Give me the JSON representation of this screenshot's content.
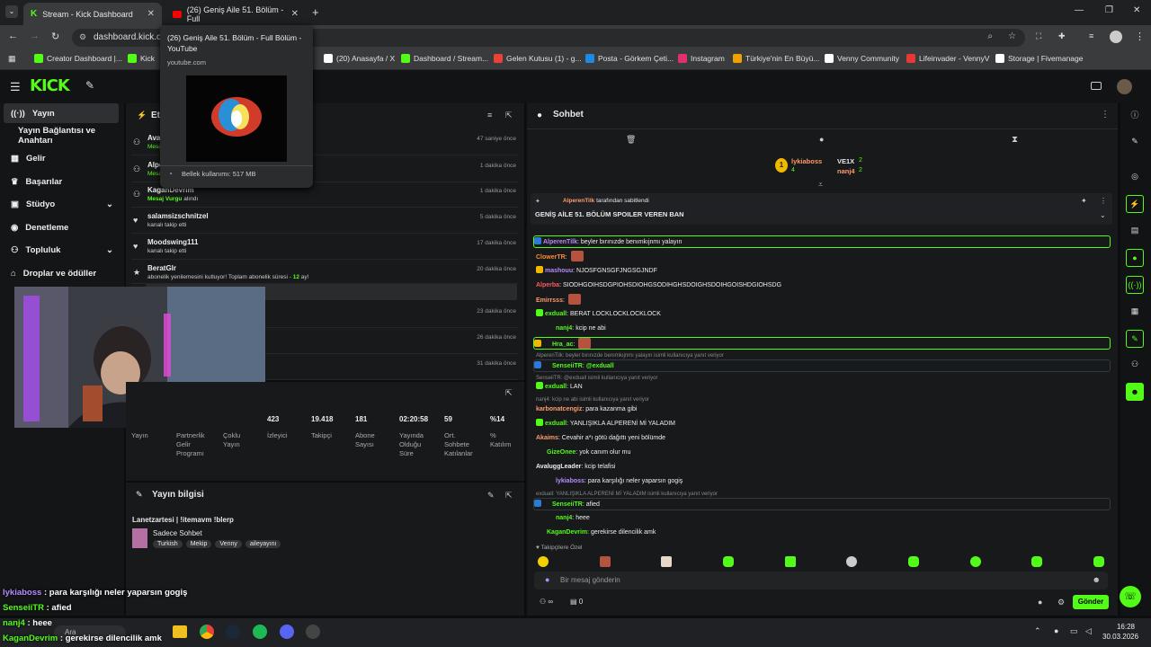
{
  "browser": {
    "tabs": [
      {
        "title": "Stream - Kick Dashboard",
        "active": true
      },
      {
        "title": "(26) Geniş Aile 51. Bölüm - Full",
        "active": false
      }
    ],
    "url": "dashboard.kick.co",
    "bookmarks": [
      {
        "label": "Creator Dashboard |...",
        "color": "#53fc18"
      },
      {
        "label": "Kick",
        "color": "#53fc18"
      },
      {
        "label": "(20) Anasayfa / X",
        "color": "#ffffff"
      },
      {
        "label": "Dashboard / Stream...",
        "color": "#53fc18"
      },
      {
        "label": "Gelen Kutusu (1) - g...",
        "color": "#ea4335"
      },
      {
        "label": "Posta - Görkem Çeti...",
        "color": "#1e88e5"
      },
      {
        "label": "Instagram",
        "color": "#e1306c"
      },
      {
        "label": "Türkiye'nin En Büyü...",
        "color": "#f0a000"
      },
      {
        "label": "Venny Community",
        "color": "#ffffff"
      },
      {
        "label": "Lifeinvader - VennyV",
        "color": "#e53935"
      },
      {
        "label": "Storage | Fivemanage",
        "color": "#ffffff"
      }
    ],
    "tooltip": {
      "title": "(26) Geniş Aile 51. Bölüm - Full Bölüm - YouTube",
      "domain": "youtube.com",
      "memory": "Bellek kullanımı: 517 MB"
    }
  },
  "sidebar": {
    "items": [
      {
        "label": "Yayın",
        "icon": "broadcast-icon",
        "active": true
      },
      {
        "label": "Yayın Bağlantısı ve Anahtarı",
        "icon": "",
        "active": false
      },
      {
        "label": "Gelir",
        "icon": "revenue-icon",
        "active": false
      },
      {
        "label": "Başarılar",
        "icon": "trophy-icon",
        "active": false
      },
      {
        "label": "Stüdyo",
        "icon": "studio-icon",
        "active": false,
        "chevron": true
      },
      {
        "label": "Denetleme",
        "icon": "moderation-icon",
        "active": false
      },
      {
        "label": "Topluluk",
        "icon": "community-icon",
        "active": false,
        "chevron": true
      },
      {
        "label": "Droplar ve ödüller",
        "icon": "drops-icon",
        "active": false
      }
    ]
  },
  "events": {
    "title": "Et",
    "items": [
      {
        "name": "Ava",
        "sub": "Mesa",
        "time": "47 saniye önce"
      },
      {
        "name": "Alpe",
        "sub": "Mesa",
        "time": "1 dakika önce"
      },
      {
        "name": "KaganDevrim",
        "sub": "Mesaj Vurgu",
        "sub2": "alındı",
        "time": "1 dakika önce"
      },
      {
        "name": "salamsizschnitzel",
        "sub": "kanalı takip etti",
        "time": "5 dakika önce"
      },
      {
        "name": "Moodswing111",
        "sub": "kanalı takip etti",
        "time": "17 dakika önce"
      },
      {
        "name": "BeratGlr",
        "sub": "abonelik yenilemesini kutluyor! Toplam abonelik süresi -",
        "sub2": "12",
        "sub3": "ay!",
        "time": "20 dakika önce"
      },
      {
        "name": "",
        "sub": "",
        "time": "23 dakika önce"
      },
      {
        "name": "",
        "sub": "",
        "time": "26 dakika önce"
      },
      {
        "name": "",
        "sub": "",
        "time": "31 dakika önce"
      }
    ]
  },
  "stats": {
    "values": [
      "423",
      "19.418",
      "181",
      "02:20:58",
      "59",
      "%14"
    ],
    "labels": [
      "Yayın",
      "Partnerlik Gelir Programı",
      "Çoklu Yayın",
      "İzleyici",
      "Takipçi",
      "Abone Sayısı",
      "Yayında Olduğu Süre",
      "Ort. Sohbete Katılanlar",
      "% Katılım"
    ]
  },
  "stream_info": {
    "header": "Yayın bilgisi",
    "title": "Lanetzartesi | !itemavm !blerp",
    "category": "Sadece Sohbet",
    "tags": [
      "Turkish",
      "Mekip",
      "Venny",
      "aileyayını"
    ]
  },
  "chat": {
    "header": "Sohbet",
    "leaders": [
      {
        "name": "lykiaboss",
        "count": "4"
      },
      {
        "name": "VE1X",
        "count": "2"
      },
      {
        "name": "nanj4",
        "count": "2"
      }
    ],
    "pinned": {
      "by_user": "AlperenTilk",
      "by_suffix": "tarafından sabitlendi",
      "text": "GENİŞ AİLE 51. BÖLÜM SPOILER VEREN BAN"
    },
    "messages": [
      {
        "user": "AlperenTilk",
        "color": "#b58cff",
        "text": "beyler bırınızde benımkıjnmı yalayın",
        "style": "hl"
      },
      {
        "user": "ClowerTR",
        "color": "#ff8c3a",
        "text": "",
        "emote": true
      },
      {
        "user": "mashouu",
        "color": "#b58cff",
        "text": "NJOSFGNSGFJNGSGJNDF"
      },
      {
        "user": "Alperba",
        "color": "#ff5a5a",
        "text": "SIODHGOIHSDGPIOHSDIOHGSODIHGHSDOIGHSDOIHGOISHDGIOHSDG"
      },
      {
        "user": "Emirrsss",
        "color": "#ff9b6a",
        "text": "",
        "emote": true
      },
      {
        "user": "exduall",
        "color": "#53fc18",
        "text": "BERAT LOCKLOCKLOCKLOCK"
      },
      {
        "user": "nanj4",
        "color": "#53fc18",
        "text": "kcip ne abi"
      },
      {
        "user": "Hra_ac",
        "color": "#53fc18",
        "text": "",
        "emote": true,
        "style": "hl"
      },
      {
        "user": "SenseiiTR",
        "color": "#53fc18",
        "text": "@exduall",
        "style": "rp",
        "reply": "AlperenTilk: beyler bırınızde benımkıjnmı yalayın isimli kullanıcıya yanıt veriyor"
      },
      {
        "user": "exduall",
        "color": "#53fc18",
        "text": "LAN",
        "reply": "SenseiiTR: @exduall isimli kullanıcıya yanıt veriyor"
      },
      {
        "user": "karbonatcengiz",
        "color": "#ff9b6a",
        "text": "para kazanma gibi",
        "reply": "nanj4: kcip ne abi isimli kullanıcıya yanıt veriyor"
      },
      {
        "user": "exduall",
        "color": "#53fc18",
        "text": "YANLIŞIKLA ALPERENİ Mİ YALADIM"
      },
      {
        "user": "Akaims",
        "color": "#ff9b6a",
        "text": "Cevahir a*ı götü dağıttı yeni bölümde"
      },
      {
        "user": "GizeOnee",
        "color": "#53fc18",
        "text": "yok canım olur mu"
      },
      {
        "user": "AvaluggLeader",
        "color": "#eeeeee",
        "text": "kcip telafisi"
      },
      {
        "user": "lykiaboss",
        "color": "#b58cff",
        "text": "para karşılığı neler yaparsın gogiş"
      },
      {
        "user": "SenseiiTR",
        "color": "#53fc18",
        "text": "afied",
        "style": "rp",
        "reply": "exduall: YANLIŞIKLA ALPERENİ Mİ YALADIM isimli kullanıcıya yanıt veriyor"
      },
      {
        "user": "nanj4",
        "color": "#53fc18",
        "text": "heee"
      },
      {
        "user": "KaganDevrim",
        "color": "#53fc18",
        "text": "gerekirse dilencilik amk"
      }
    ],
    "follower_label": "Takipçilere Özel",
    "input_placeholder": "Bir mesaj gönderin",
    "send_label": "Gönder",
    "viewers_count": "0",
    "infinity": "∞"
  },
  "overlay": [
    {
      "user": "lykiaboss",
      "text": "para karşılığı neler yaparsın gogiş",
      "color": "#b58cff"
    },
    {
      "user": "SenseiiTR",
      "text": "afied",
      "color": "#53fc18"
    },
    {
      "user": "nanj4",
      "text": "heee",
      "color": "#53fc18"
    },
    {
      "user": "KaganDevrim",
      "text": "gerekirse dilencilik amk",
      "color": "#53fc18"
    }
  ],
  "taskbar": {
    "time": "16:28",
    "date": "30.03.2026",
    "search": "Ara"
  },
  "colors": {
    "accent": "#53fc18",
    "background": "#0b0d0f",
    "panel": "#18191b"
  }
}
